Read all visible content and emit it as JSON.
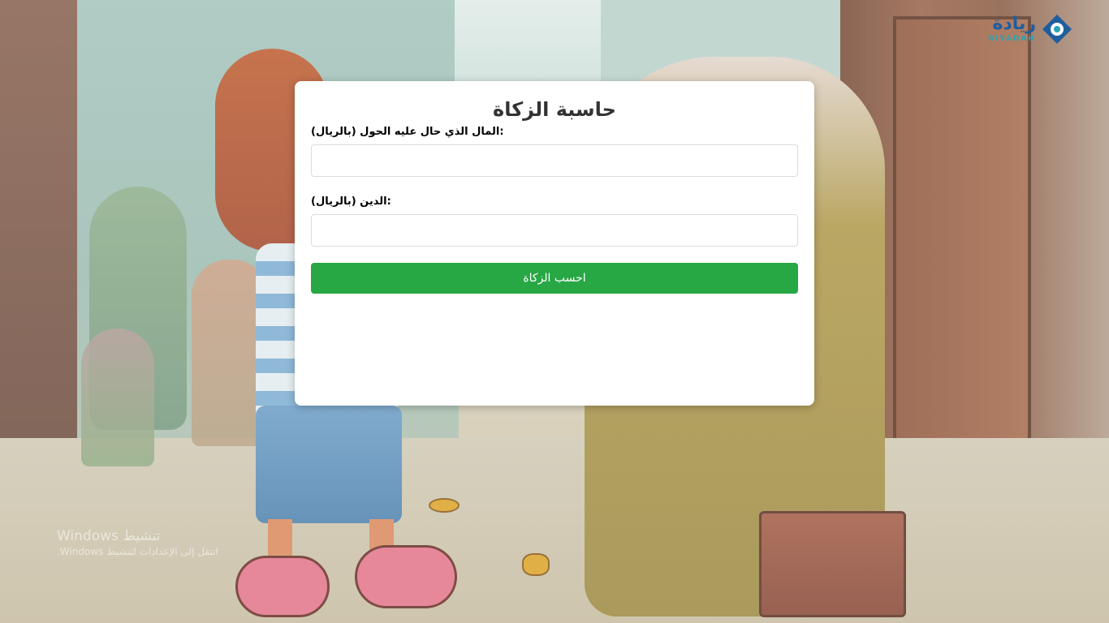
{
  "logo": {
    "arabic_text": "ريادة",
    "english_text": "RIYADAH",
    "icon": "riyadah-logo-icon",
    "colors": {
      "primary": "#1f5e9e",
      "secondary": "#2aa3b4"
    }
  },
  "calculator": {
    "title": "حاسبة الزكاة",
    "fields": [
      {
        "label": "المال الذي حال عليه الحول (بالريال):",
        "value": "",
        "placeholder": ""
      },
      {
        "label": "الدين (بالريال):",
        "value": "",
        "placeholder": ""
      }
    ],
    "submit_label": "احسب الزكاة",
    "button_color": "#28a745"
  },
  "watermark": {
    "title": "تنشيط Windows",
    "subtitle": "انتقل إلى الإعدادات لتنشيط Windows."
  }
}
